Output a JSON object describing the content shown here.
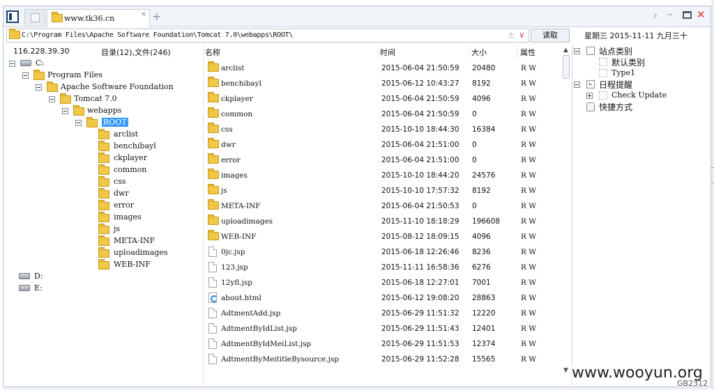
{
  "tabs": [
    {
      "label": "www.tk36.cn",
      "close": "×"
    }
  ],
  "tab_add": "+",
  "window_controls": {
    "chevron": "›",
    "minimize": "–",
    "close": "✕"
  },
  "address": {
    "path": "C:\\Program Files\\Apache Software Foundation\\Tomcat 7.0\\webapps\\ROOT\\",
    "pm": "±",
    "dropdown": "∨"
  },
  "read_button": "读取",
  "date_line": "星期三 2015-11-11 九月三十",
  "info": {
    "ip": "116.228.39.30",
    "counts": "目录(12),文件(246)"
  },
  "tree": {
    "c_drive": "C:",
    "program_files": "Program Files",
    "apache": "Apache Software Foundation",
    "tomcat": "Tomcat 7.0",
    "webapps": "webapps",
    "root": "ROOT",
    "root_children": [
      "arclist",
      "benchibayl",
      "ckplayer",
      "common",
      "css",
      "dwr",
      "error",
      "images",
      "js",
      "META-INF",
      "uploadimages",
      "WEB-INF"
    ],
    "d_drive": "D:",
    "e_drive": "E:"
  },
  "list_headers": {
    "name": "名称",
    "time": "时间",
    "size": "大小",
    "attr": "属性"
  },
  "files": [
    {
      "type": "folder",
      "name": "arclist",
      "time": "2015-06-04 21:50:59",
      "size": "20480",
      "attr": "R W"
    },
    {
      "type": "folder",
      "name": "benchibayl",
      "time": "2015-06-12 10:43:27",
      "size": "8192",
      "attr": "R W"
    },
    {
      "type": "folder",
      "name": "ckplayer",
      "time": "2015-06-04 21:50:59",
      "size": "4096",
      "attr": "R W"
    },
    {
      "type": "folder",
      "name": "common",
      "time": "2015-06-04 21:50:59",
      "size": "0",
      "attr": "R W"
    },
    {
      "type": "folder",
      "name": "css",
      "time": "2015-10-10 18:44:30",
      "size": "16384",
      "attr": "R W"
    },
    {
      "type": "folder",
      "name": "dwr",
      "time": "2015-06-04 21:51:00",
      "size": "0",
      "attr": "R W"
    },
    {
      "type": "folder",
      "name": "error",
      "time": "2015-06-04 21:51:00",
      "size": "0",
      "attr": "R W"
    },
    {
      "type": "folder",
      "name": "images",
      "time": "2015-10-10 18:44:20",
      "size": "24576",
      "attr": "R W"
    },
    {
      "type": "folder",
      "name": "js",
      "time": "2015-10-10 17:57:32",
      "size": "8192",
      "attr": "R W"
    },
    {
      "type": "folder",
      "name": "META-INF",
      "time": "2015-06-04 21:50:53",
      "size": "0",
      "attr": "R W"
    },
    {
      "type": "folder",
      "name": "uploadimages",
      "time": "2015-11-10 18:18:29",
      "size": "196608",
      "attr": "R W"
    },
    {
      "type": "folder",
      "name": "WEB-INF",
      "time": "2015-08-12 18:09:15",
      "size": "4096",
      "attr": "R W"
    },
    {
      "type": "file",
      "name": "0jc.jsp",
      "time": "2015-06-18 12:26:46",
      "size": "8236",
      "attr": "R W"
    },
    {
      "type": "file",
      "name": "123.jsp",
      "time": "2015-11-11 16:58:36",
      "size": "6276",
      "attr": "R W"
    },
    {
      "type": "file",
      "name": "12yfl.jsp",
      "time": "2015-06-18 12:27:01",
      "size": "7001",
      "attr": "R W"
    },
    {
      "type": "html",
      "name": "about.html",
      "time": "2015-06-12 19:08:20",
      "size": "28863",
      "attr": "R W"
    },
    {
      "type": "file",
      "name": "AdtmentAdd.jsp",
      "time": "2015-06-29 11:51:32",
      "size": "12220",
      "attr": "R W"
    },
    {
      "type": "file",
      "name": "AdtmentByIdList.jsp",
      "time": "2015-06-29 11:51:43",
      "size": "12401",
      "attr": "R W"
    },
    {
      "type": "file",
      "name": "AdtmentByIdMeiList.jsp",
      "time": "2015-06-29 11:51:53",
      "size": "12374",
      "attr": "R W"
    },
    {
      "type": "file",
      "name": "AdtmentByMeititleBysource.jsp",
      "time": "2015-06-29 11:52:28",
      "size": "15565",
      "attr": "R W"
    }
  ],
  "scrollbar": {
    "up": "▲",
    "down": "▼"
  },
  "right_panel": {
    "site_category": "站点类别",
    "default_category": "默认类别",
    "type1": "Type1",
    "schedule": "日程提醒",
    "check_update": "Check Update",
    "shortcuts": "快捷方式"
  },
  "watermark": "www.wooyun.org",
  "encoding_badge": "GB2312"
}
